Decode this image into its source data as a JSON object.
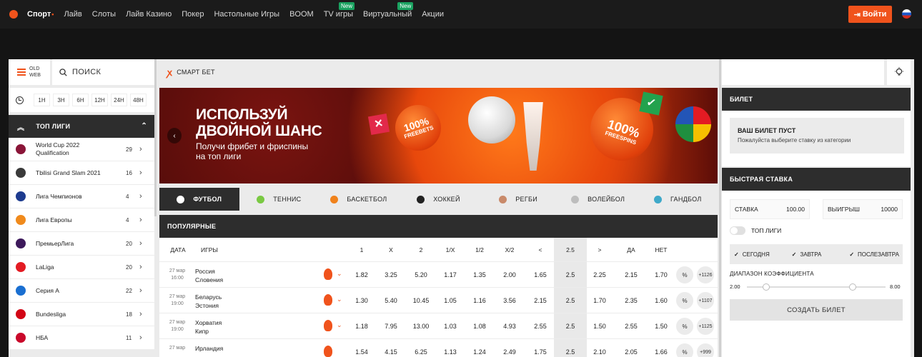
{
  "topbar": {
    "nav": [
      {
        "label": "Спорт",
        "badge": ""
      },
      {
        "label": "Лайв",
        "badge": ""
      },
      {
        "label": "Слоты",
        "badge": ""
      },
      {
        "label": "Лайв Казино",
        "badge": ""
      },
      {
        "label": "Покер",
        "badge": ""
      },
      {
        "label": "Настольные Игры",
        "badge": ""
      },
      {
        "label": "BOOM",
        "badge": ""
      },
      {
        "label": "TV игры",
        "badge": "New"
      },
      {
        "label": "Виртуальный",
        "badge": "New"
      },
      {
        "label": "Акции",
        "badge": ""
      }
    ],
    "login_label": "Войти",
    "accent_color": "#f0531c"
  },
  "left": {
    "oldweb_label_1": "OLD",
    "oldweb_label_2": "WEB",
    "search_label": "ПОИСК",
    "time_filters": [
      "1H",
      "3H",
      "6H",
      "12H",
      "24H",
      "48H"
    ],
    "top_leagues_title": "ТОП ЛИГИ",
    "leagues": [
      {
        "name": "World Cup 2022 Qualification",
        "count": "29",
        "color": "#8a1538"
      },
      {
        "name": "Tbilisi Grand Slam 2021",
        "count": "16",
        "color": "#3a3a3a"
      },
      {
        "name": "Лига Чемпионов",
        "count": "4",
        "color": "#1d3b8f"
      },
      {
        "name": "Лига Европы",
        "count": "4",
        "color": "#f08a1c"
      },
      {
        "name": "ПремьерЛига",
        "count": "20",
        "color": "#3d195b"
      },
      {
        "name": "LaLiga",
        "count": "20",
        "color": "#e31b23"
      },
      {
        "name": "Серия A",
        "count": "22",
        "color": "#1a6fd1"
      },
      {
        "name": "Bundesliga",
        "count": "18",
        "color": "#d20515"
      },
      {
        "name": "НБА",
        "count": "11",
        "color": "#c9082a"
      }
    ]
  },
  "center": {
    "smartbet_label": "СМАРТ БЕТ",
    "banner": {
      "title_line1": "ИСПОЛЬЗУЙ",
      "title_line2": "ДВОЙНОЙ ШАНС",
      "subtitle_line1": "Получи фрибет и фриспины",
      "subtitle_line2": "на топ лиги",
      "promo1_value": "100%",
      "promo1_label": "FREEBETS",
      "promo2_value": "100%",
      "promo2_label": "FREESPINS"
    },
    "sports": [
      {
        "label": "ФУТБОЛ",
        "color": "#ffffff"
      },
      {
        "label": "ТЕННИС",
        "color": "#7ac943"
      },
      {
        "label": "БАСКЕТБОЛ",
        "color": "#f0821c"
      },
      {
        "label": "ХОККЕЙ",
        "color": "#222222"
      },
      {
        "label": "РЕГБИ",
        "color": "#c98a6a"
      },
      {
        "label": "ВОЛЕЙБОЛ",
        "color": "#bdbdbd"
      },
      {
        "label": "ГАНДБОЛ",
        "color": "#3fa9c9"
      }
    ],
    "popular_title": "ПОПУЛЯРНЫЕ",
    "columns": {
      "date": "ДАТА",
      "games": "ИГРЫ",
      "c1": "1",
      "cx": "X",
      "c2": "2",
      "c1x": "1/X",
      "c12": "1/2",
      "cx2": "X/2",
      "lt": "<",
      "total": "2.5",
      "gt": ">",
      "yes": "ДА",
      "no": "НЕТ"
    },
    "matches": [
      {
        "date": "27 мар",
        "time": "16:00",
        "team1": "Россия",
        "team2": "Словения",
        "odds": [
          "1.82",
          "3.25",
          "5.20",
          "1.17",
          "1.35",
          "2.00",
          "1.65",
          "2.5",
          "2.25",
          "2.15",
          "1.70"
        ],
        "pct": "%",
        "more": "+1126"
      },
      {
        "date": "27 мар",
        "time": "19:00",
        "team1": "Беларусь",
        "team2": "Эстония",
        "odds": [
          "1.30",
          "5.40",
          "10.45",
          "1.05",
          "1.16",
          "3.56",
          "2.15",
          "2.5",
          "1.70",
          "2.35",
          "1.60"
        ],
        "pct": "%",
        "more": "+1107"
      },
      {
        "date": "27 мар",
        "time": "19:00",
        "team1": "Хорватия",
        "team2": "Кипр",
        "odds": [
          "1.18",
          "7.95",
          "13.00",
          "1.03",
          "1.08",
          "4.93",
          "2.55",
          "2.5",
          "1.50",
          "2.55",
          "1.50"
        ],
        "pct": "%",
        "more": "+1125"
      },
      {
        "date": "27 мар",
        "time": "",
        "team1": "Ирландия",
        "team2": "",
        "odds": [
          "1.54",
          "4.15",
          "6.25",
          "1.13",
          "1.24",
          "2.49",
          "1.75",
          "2.5",
          "2.10",
          "2.05",
          "1.66"
        ],
        "pct": "%",
        "more": "+999"
      }
    ]
  },
  "right": {
    "ticket_title": "БИЛЕТ",
    "ticket_empty_title": "ВАШ БИЛЕТ ПУСТ",
    "ticket_empty_sub": "Пожалуйста выберите ставку из категории",
    "quick_title": "БЫСТРАЯ СТАВКА",
    "stake_label": "СТАВКА",
    "stake_value": "100.00",
    "win_label": "ВЫИГРЫШ",
    "win_value": "10000",
    "toggle_label": "ТОП ЛИГИ",
    "days": [
      "СЕГОДНЯ",
      "ЗАВТРА",
      "ПОСЛЕЗАВТРА"
    ],
    "range_label": "ДИАПАЗОН КОЭФФИЦИЕНТА",
    "range_min": "2.00",
    "range_max": "8.00",
    "create_label": "СОЗДАТЬ БИЛЕТ"
  }
}
